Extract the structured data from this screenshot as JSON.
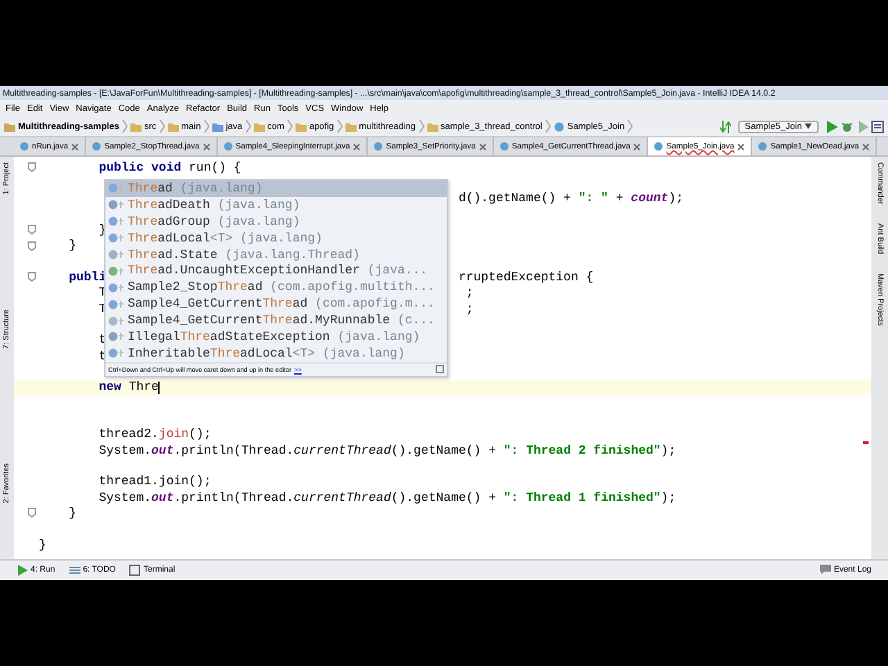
{
  "window": {
    "title": "Multithreading-samples - [E:\\JavaForFun\\Multithreading-samples] - [Multithreading-samples] - ...\\src\\main\\java\\com\\apofig\\multithreading\\sample_3_thread_control\\Sample5_Join.java - IntelliJ IDEA 14.0.2"
  },
  "menu": [
    "File",
    "Edit",
    "View",
    "Navigate",
    "Code",
    "Analyze",
    "Refactor",
    "Build",
    "Run",
    "Tools",
    "VCS",
    "Window",
    "Help"
  ],
  "breadcrumbs": [
    {
      "label": "Multithreading-samples",
      "kind": "project"
    },
    {
      "label": "src",
      "kind": "folder"
    },
    {
      "label": "main",
      "kind": "folder"
    },
    {
      "label": "java",
      "kind": "source"
    },
    {
      "label": "com",
      "kind": "folder"
    },
    {
      "label": "apofig",
      "kind": "folder"
    },
    {
      "label": "multithreading",
      "kind": "folder"
    },
    {
      "label": "sample_3_thread_control",
      "kind": "folder"
    },
    {
      "label": "Sample5_Join",
      "kind": "class"
    }
  ],
  "run_config": "Sample5_Join",
  "tabs": [
    {
      "label": "nRun.java",
      "selected": false
    },
    {
      "label": "Sample2_StopThread.java",
      "selected": false
    },
    {
      "label": "Sample4_SleepingInterrupt.java",
      "selected": false
    },
    {
      "label": "Sample3_SetPriority.java",
      "selected": false
    },
    {
      "label": "Sample4_GetCurrentThread.java",
      "selected": false
    },
    {
      "label": "Sample5_Join.java",
      "selected": true
    },
    {
      "label": "Sample1_NewDead.java",
      "selected": false
    }
  ],
  "left_stripe": [
    "1: Project",
    "7: Structure",
    "2: Favorites"
  ],
  "right_stripe": [
    "Commander",
    "Ant Build",
    "Maven Projects"
  ],
  "lines": [
    {
      "kind": "code",
      "fold": true,
      "left": [
        {
          "t": "        public void",
          "kind": "kw"
        },
        {
          "t": " run() {"
        }
      ]
    },
    {
      "kind": "blank"
    },
    {
      "kind": "code",
      "right": [
        {
          "t": "d().getName() + "
        },
        {
          "t": "\": \"",
          "kind": "str"
        },
        {
          "t": " + "
        },
        {
          "t": "count",
          "kind": "field"
        },
        {
          "t": ");"
        }
      ]
    },
    {
      "kind": "blank"
    },
    {
      "kind": "code",
      "fold": true,
      "left": [
        {
          "t": "        }"
        }
      ]
    },
    {
      "kind": "code",
      "fold": true,
      "left": [
        {
          "t": "    }"
        }
      ]
    },
    {
      "kind": "blank"
    },
    {
      "kind": "code",
      "fold": true,
      "left": [
        {
          "t": "    publi",
          "kind": "kw"
        }
      ],
      "right": [
        {
          "t": "rruptedException {"
        }
      ]
    },
    {
      "kind": "code",
      "left": [
        {
          "t": "        T"
        }
      ],
      "right": [
        {
          "t": " ;"
        }
      ]
    },
    {
      "kind": "code",
      "left": [
        {
          "t": "        T"
        }
      ],
      "right": [
        {
          "t": " ;"
        }
      ]
    },
    {
      "kind": "blank"
    },
    {
      "kind": "code",
      "left": [
        {
          "t": "        t"
        }
      ]
    },
    {
      "kind": "code",
      "left": [
        {
          "t": "        t"
        }
      ]
    },
    {
      "kind": "blank"
    },
    {
      "kind": "code",
      "current": true,
      "left": [
        {
          "t": "        new",
          "kind": "kw"
        },
        {
          "t": " Thre"
        }
      ]
    },
    {
      "kind": "blank"
    },
    {
      "kind": "blank"
    },
    {
      "kind": "code",
      "left": [
        {
          "t": "        thread2."
        },
        {
          "t": "join",
          "kind": "err"
        },
        {
          "t": "();"
        }
      ]
    },
    {
      "kind": "code",
      "left": [
        {
          "t": "        System."
        },
        {
          "t": "out",
          "kind": "field"
        },
        {
          "t": ".println(Thread."
        },
        {
          "t": "currentThread",
          "kind": "italic"
        },
        {
          "t": "().getName() + "
        },
        {
          "t": "\": Thread 2 finished\"",
          "kind": "str"
        },
        {
          "t": ");"
        }
      ]
    },
    {
      "kind": "blank"
    },
    {
      "kind": "code",
      "left": [
        {
          "t": "        thread1.join();"
        }
      ]
    },
    {
      "kind": "code",
      "left": [
        {
          "t": "        System."
        },
        {
          "t": "out",
          "kind": "field"
        },
        {
          "t": ".println(Thread."
        },
        {
          "t": "currentThread",
          "kind": "italic"
        },
        {
          "t": "().getName() + "
        },
        {
          "t": "\": Thread 1 finished\"",
          "kind": "str"
        },
        {
          "t": ");"
        }
      ]
    },
    {
      "kind": "code",
      "fold": true,
      "left": [
        {
          "t": "    }"
        }
      ]
    },
    {
      "kind": "blank"
    },
    {
      "kind": "code",
      "left": [
        {
          "t": "}"
        }
      ]
    }
  ],
  "completion": {
    "items": [
      {
        "kind": "class",
        "selected": true,
        "match": "Thre",
        "after": "ad",
        "hint": " (java.lang)"
      },
      {
        "kind": "exception",
        "selected": false,
        "match": "Thre",
        "after": "adDeath",
        "hint": " (java.lang)"
      },
      {
        "kind": "class",
        "selected": false,
        "match": "Thre",
        "after": "adGroup",
        "hint": " (java.lang)"
      },
      {
        "kind": "class",
        "selected": false,
        "match": "Thre",
        "after": "adLocal",
        "hint": "<T> (java.lang)"
      },
      {
        "kind": "enum",
        "selected": false,
        "match": "Thre",
        "after": "ad.State",
        "hint": " (java.lang.Thread)"
      },
      {
        "kind": "interface",
        "selected": false,
        "match": "Thre",
        "after": "ad.UncaughtExceptionHandler",
        "hint": " (java..."
      },
      {
        "kind": "class",
        "selected": false,
        "before": "Sample2_Stop",
        "match": "Thre",
        "after": "ad",
        "hint": " (com.apofig.multith..."
      },
      {
        "kind": "class",
        "selected": false,
        "before": "Sample4_GetCurrent",
        "match": "Thre",
        "after": "ad",
        "hint": " (com.apofig.m..."
      },
      {
        "kind": "inner",
        "selected": false,
        "before": "Sample4_GetCurrent",
        "match": "Thre",
        "after": "ad.MyRunnable",
        "hint": " (c..."
      },
      {
        "kind": "exception",
        "selected": false,
        "before": "Illegal",
        "match": "Thre",
        "after": "adStateException",
        "hint": " (java.lang)"
      },
      {
        "kind": "class",
        "selected": false,
        "before": "Inheritable",
        "match": "Thre",
        "after": "adLocal",
        "hint": "<T> (java.lang)"
      }
    ],
    "footer": "Ctrl+Down and Ctrl+Up will move caret down and up in the editor",
    "footer_link": ">>"
  },
  "tool_buttons": [
    {
      "label": "4: Run",
      "kind": "run"
    },
    {
      "label": "6: TODO",
      "kind": "todo"
    },
    {
      "label": "Terminal",
      "kind": "terminal"
    }
  ],
  "event_log": "Event Log"
}
